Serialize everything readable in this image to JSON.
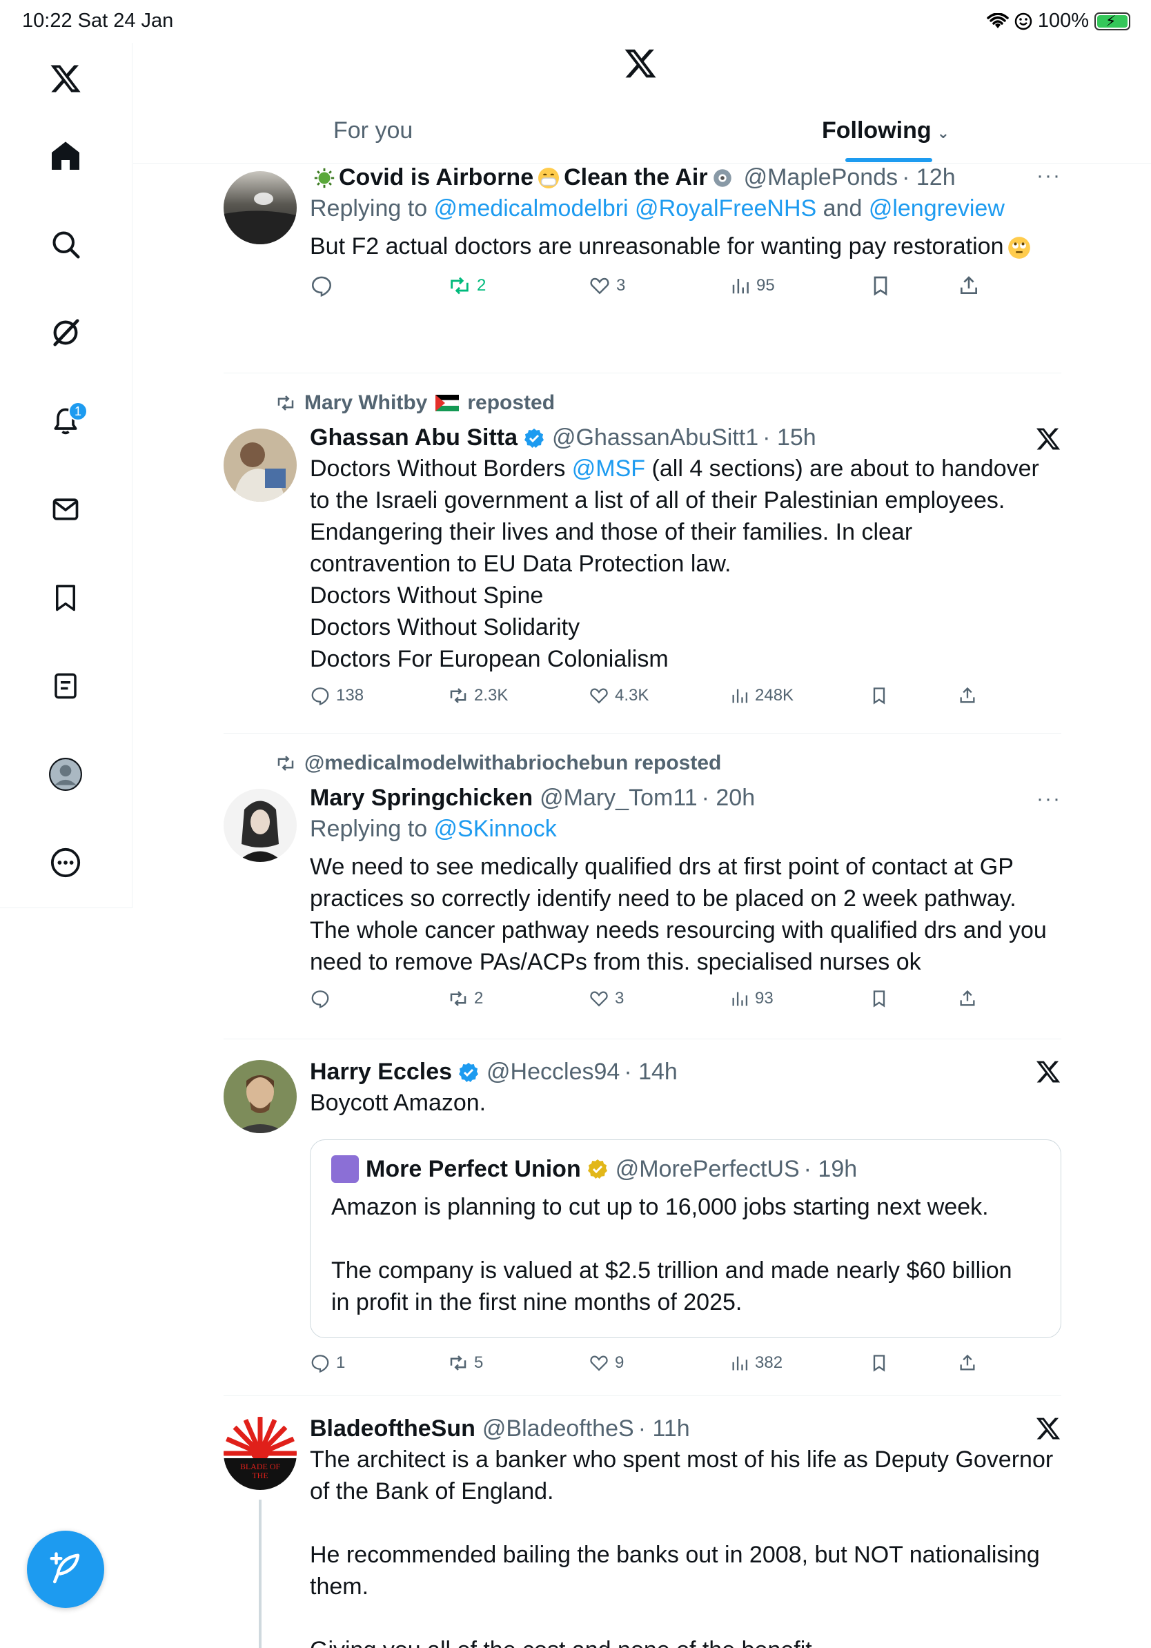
{
  "status": {
    "time": "10:22  Sat 24 Jan",
    "battery": "100%"
  },
  "nav": {
    "notifications_badge": "1"
  },
  "tabs": {
    "for_you": "For you",
    "following": "Following"
  },
  "posts": [
    {
      "name": "Covid is Airborne",
      "name2": "Clean the Air",
      "handle": "@MaplePonds",
      "time": "· 12h",
      "reply_prefix": "Replying to ",
      "reply_users": "@medicalmodelbri @RoyalFreeNHS",
      "reply_and": " and ",
      "reply_last": "@lengreview",
      "text": [
        "But F2 actual doctors are unreasonable for wanting pay restoration"
      ],
      "replies": "",
      "retweets": "2",
      "likes": "3",
      "views": "95"
    },
    {
      "social": "Mary Whitby",
      "social_suffix": "reposted",
      "name": "Ghassan Abu Sitta",
      "handle": "@GhassanAbuSitt1",
      "time": "· 15h",
      "text_prefix": "Doctors Without Borders ",
      "text_link": "@MSF",
      "text_rest": " (all 4 sections) are about to handover",
      "text": [
        "to the Israeli government  a list of all of their Palestinian employees.",
        "Endangering their lives and those of their families.  In clear",
        "contravention to EU Data Protection law.",
        "Doctors Without Spine",
        "Doctors Without Solidarity",
        "Doctors For European Colonialism"
      ],
      "replies": "138",
      "retweets": "2.3K",
      "likes": "4.3K",
      "views": "248K"
    },
    {
      "social": "@medicalmodelwithabriochebun reposted",
      "name": "Mary Springchicken",
      "handle": "@Mary_Tom11",
      "time": "· 20h",
      "reply_prefix": "Replying to ",
      "reply_users": "@SKinnock",
      "text": [
        "We need to see medically qualified drs at first point of contact at GP",
        "practices so correctly identify need to be placed on 2 week pathway.",
        "The whole cancer pathway needs resourcing with qualified drs and you",
        "need to remove PAs/ACPs from this. specialised nurses ok"
      ],
      "replies": "",
      "retweets": "2",
      "likes": "3",
      "views": "93"
    },
    {
      "name": "Harry Eccles",
      "handle": "@Heccles94",
      "time": "· 14h",
      "text": [
        "Boycott Amazon."
      ],
      "quote": {
        "name": "More Perfect Union",
        "handle": "@MorePerfectUS",
        "time": "· 19h",
        "text": [
          "Amazon is planning to cut up to 16,000 jobs starting next week.",
          "",
          "The company is valued at $2.5 trillion and made nearly $60 billion",
          "in profit in the first nine months of 2025."
        ]
      },
      "replies": "1",
      "retweets": "5",
      "likes": "9",
      "views": "382"
    },
    {
      "name": "BladeoftheSun",
      "handle": "@BladeoftheS",
      "time": "· 11h",
      "avatar_text": "BLADE OF THE",
      "text": [
        "The architect is a banker who spent most of his life as Deputy Governor",
        "of the Bank of England.",
        "",
        "He recommended bailing the banks out in 2008, but NOT nationalising",
        "them.",
        "",
        "Giving you all of the cost and none of the benefit."
      ]
    }
  ],
  "colors": {
    "accent": "#1d9bf0",
    "retweet_active": "#00ba7c",
    "secondary": "#536471"
  }
}
